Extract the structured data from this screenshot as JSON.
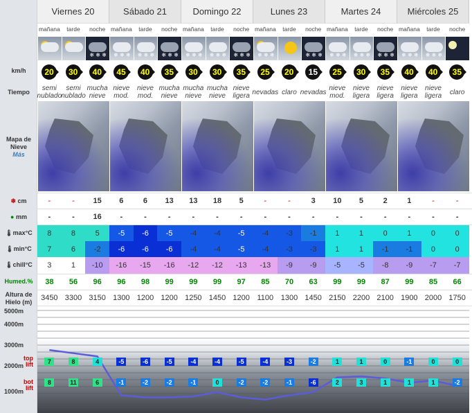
{
  "days": [
    "Viernes 20",
    "Sábado 21",
    "Domingo 22",
    "Lunes 23",
    "Martes 24",
    "Miércoles 25"
  ],
  "periods": [
    "mañana",
    "tarde",
    "noche"
  ],
  "labels": {
    "wind": "km/h",
    "weather": "Tiempo",
    "map1": "Mapa de",
    "map2": "Nieve",
    "map3": "Más",
    "snow_cm": "cm",
    "rain_mm": "mm",
    "max": "max°C",
    "min": "min°C",
    "chill": "chill°C",
    "hum": "Humed.%",
    "ice1": "Altura de",
    "ice2": "Hielo (m)",
    "top": "top",
    "lift1": "lift",
    "bot": "bot",
    "lift2": "lift"
  },
  "wind": [
    "20",
    "30",
    "40",
    "45",
    "40",
    "35",
    "30",
    "30",
    "35",
    "25",
    "20",
    "15",
    "25",
    "30",
    "35",
    "40",
    "40",
    "35"
  ],
  "weather": [
    "semi nublado",
    "semi nublado",
    "mucha nieve",
    "nieve mod.",
    "nieve mod.",
    "mucha nieve",
    "mucha nieve",
    "mucha nieve",
    "nieve ligera",
    "nevadas",
    "claro",
    "nevadas",
    "nieve mod.",
    "nieve ligera",
    "nieve ligera",
    "nieve ligera",
    "nieve ligera",
    "claro"
  ],
  "snow": [
    "-",
    "-",
    "15",
    "6",
    "6",
    "13",
    "13",
    "18",
    "5",
    "-",
    "-",
    "3",
    "10",
    "5",
    "2",
    "1",
    "-",
    "-"
  ],
  "rain": [
    "-",
    "-",
    "16",
    "-",
    "-",
    "-",
    "-",
    "-",
    "-",
    "-",
    "-",
    "-",
    "-",
    "-",
    "-",
    "-",
    "-",
    "-"
  ],
  "tmax": [
    "8",
    "8",
    "5",
    "-5",
    "-6",
    "-5",
    "-4",
    "-4",
    "-5",
    "-4",
    "-3",
    "-1",
    "1",
    "1",
    "0",
    "1",
    "0",
    "0"
  ],
  "tmin": [
    "7",
    "6",
    "-2",
    "-6",
    "-6",
    "-6",
    "-4",
    "-4",
    "-5",
    "-4",
    "-3",
    "-3",
    "1",
    "1",
    "-1",
    "-1",
    "0",
    "0"
  ],
  "chill": [
    "3",
    "1",
    "-10",
    "-16",
    "-15",
    "-16",
    "-12",
    "-12",
    "-13",
    "-13",
    "-9",
    "-9",
    "-5",
    "-5",
    "-8",
    "-9",
    "-7",
    "-7"
  ],
  "hum": [
    "38",
    "56",
    "96",
    "96",
    "98",
    "99",
    "99",
    "99",
    "97",
    "85",
    "70",
    "63",
    "99",
    "99",
    "87",
    "99",
    "85",
    "66"
  ],
  "ice": [
    "3450",
    "3300",
    "3150",
    "1300",
    "1200",
    "1200",
    "1250",
    "1450",
    "1200",
    "1100",
    "1300",
    "1450",
    "2150",
    "2200",
    "2100",
    "1900",
    "2000",
    "1750"
  ],
  "altlabels": [
    "5000m",
    "4000m",
    "3000m",
    "2000m",
    "1000m"
  ],
  "toplift": [
    "7",
    "8",
    "4",
    "-5",
    "-6",
    "-5",
    "-4",
    "-4",
    "-5",
    "-4",
    "-3",
    "-2",
    "1",
    "1",
    "0",
    "-1",
    "0",
    "0"
  ],
  "botlift": [
    "8",
    "11",
    "6",
    "-1",
    "-2",
    "-2",
    "-1",
    "0",
    "-2",
    "-2",
    "-1",
    "-6",
    "2",
    "3",
    "1",
    "1",
    "1",
    "-2"
  ]
}
